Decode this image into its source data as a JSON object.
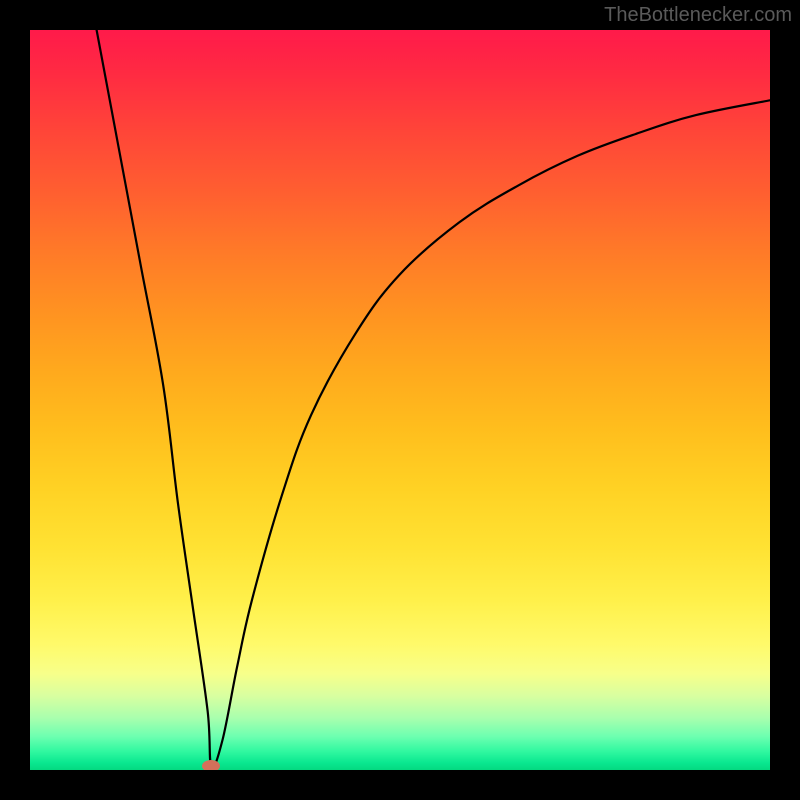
{
  "watermark": "TheBottlenecker.com",
  "chart_data": {
    "type": "line",
    "title": "",
    "xlabel": "",
    "ylabel": "",
    "xlim": [
      0,
      100
    ],
    "ylim": [
      0,
      100
    ],
    "legend_position": "none",
    "grid": false,
    "background_gradient": {
      "top": "#ff1a4a",
      "mid_upper": "#ff7a28",
      "mid": "#ffd224",
      "mid_lower": "#fffa6a",
      "bottom": "#04d980"
    },
    "series": [
      {
        "name": "bottleneck-curve",
        "color": "#000000",
        "x": [
          9,
          12,
          15,
          18,
          20,
          22,
          24,
          24.5,
          26,
          28,
          30,
          34,
          38,
          44,
          50,
          58,
          66,
          74,
          82,
          90,
          100
        ],
        "y": [
          100,
          84,
          68,
          52,
          36,
          22,
          8,
          0.5,
          4,
          14,
          23,
          37,
          48,
          59,
          67,
          74,
          79,
          83,
          86,
          88.5,
          90.5
        ]
      }
    ],
    "marker": {
      "name": "optimal-point",
      "x": 24.5,
      "y": 0.5,
      "color": "#d4705a"
    }
  }
}
